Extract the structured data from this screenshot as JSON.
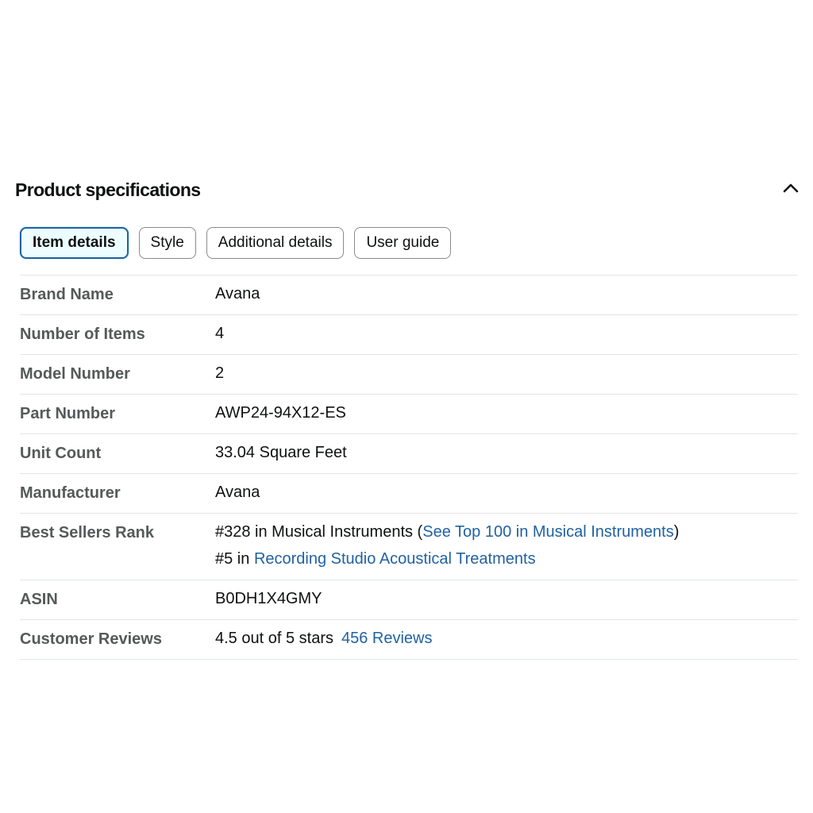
{
  "section": {
    "title": "Product specifications",
    "collapse_icon": "chevron-up-icon"
  },
  "tabs": [
    {
      "label": "Item details",
      "active": true
    },
    {
      "label": "Style",
      "active": false
    },
    {
      "label": "Additional details",
      "active": false
    },
    {
      "label": "User guide",
      "active": false
    }
  ],
  "specs": {
    "brand_name": {
      "label": "Brand Name",
      "value": "Avana"
    },
    "number_of_items": {
      "label": "Number of Items",
      "value": "4"
    },
    "model_number": {
      "label": "Model Number",
      "value": "2"
    },
    "part_number": {
      "label": "Part Number",
      "value": "AWP24-94X12-ES"
    },
    "unit_count": {
      "label": "Unit Count",
      "value": "33.04 Square Feet"
    },
    "manufacturer": {
      "label": "Manufacturer",
      "value": "Avana"
    },
    "best_sellers_rank": {
      "label": "Best Sellers Rank",
      "rank1_prefix": "#328 in Musical Instruments (",
      "rank1_link": "See Top 100 in Musical Instruments",
      "rank1_suffix": ")",
      "rank2_prefix": "#5 in ",
      "rank2_link": "Recording Studio Acoustical Treatments"
    },
    "asin": {
      "label": "ASIN",
      "value": "B0DH1X4GMY"
    },
    "customer_reviews": {
      "label": "Customer Reviews",
      "rating_text": "4.5 out of 5 stars",
      "review_count": "456",
      "reviews_word": "Reviews"
    }
  },
  "colors": {
    "link": "#2162a1",
    "active_tab_border": "#2162a1",
    "label_text": "#565959"
  }
}
